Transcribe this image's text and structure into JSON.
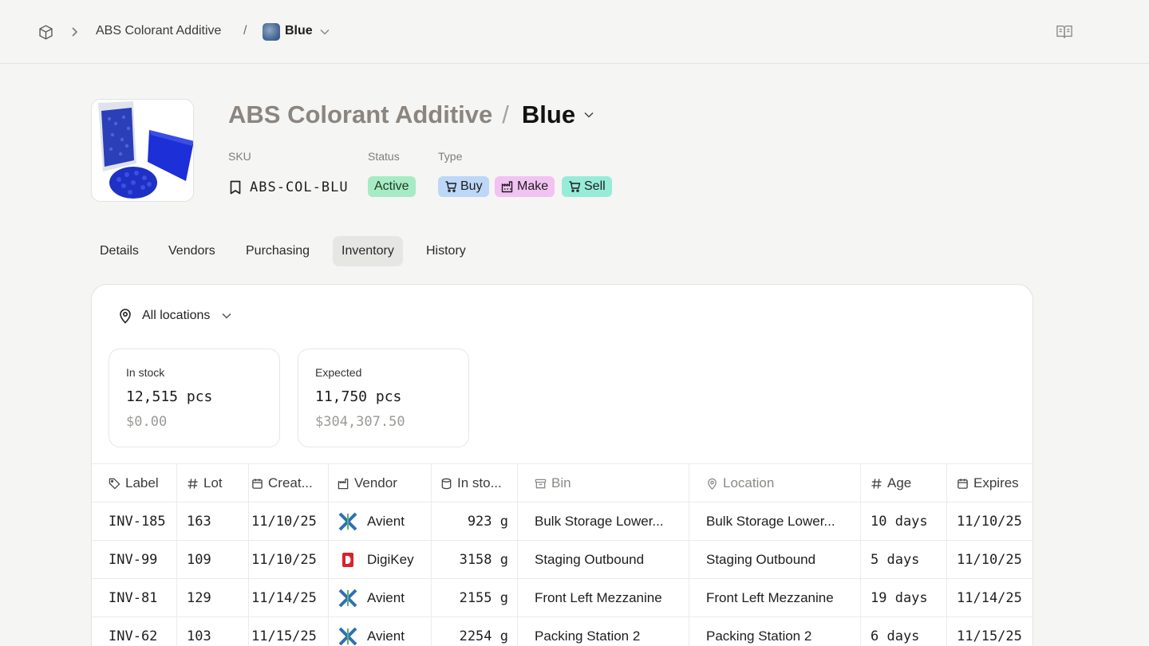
{
  "breadcrumb": {
    "parent": "ABS Colorant Additive",
    "separator": "/",
    "current": "Blue"
  },
  "header": {
    "title_parent": "ABS Colorant Additive",
    "title_separator": "/",
    "title_current": "Blue",
    "sku_label": "SKU",
    "sku_value": "ABS-COL-BLU",
    "status_label": "Status",
    "status_value": "Active",
    "type_label": "Type",
    "types": [
      "Buy",
      "Make",
      "Sell"
    ]
  },
  "tabs": [
    "Details",
    "Vendors",
    "Purchasing",
    "Inventory",
    "History"
  ],
  "active_tab": "Inventory",
  "inventory": {
    "location_filter": "All locations",
    "in_stock": {
      "label": "In stock",
      "quantity": "12,515 pcs",
      "value": "$0.00"
    },
    "expected": {
      "label": "Expected",
      "quantity": "11,750 pcs",
      "value": "$304,307.50"
    }
  },
  "table": {
    "headers": [
      "Label",
      "Lot",
      "Creat...",
      "Vendor",
      "In sto...",
      "Bin",
      "Location",
      "Age",
      "Expires"
    ],
    "rows": [
      {
        "label": "INV-185",
        "lot": "163",
        "created": "11/10/25",
        "vendor": "Avient",
        "in_stock": "923 g",
        "bin": "Bulk Storage Lower...",
        "location": "Bulk Storage Lower...",
        "age": "10 days",
        "expires": "11/10/25"
      },
      {
        "label": "INV-99",
        "lot": "109",
        "created": "11/10/25",
        "vendor": "DigiKey",
        "in_stock": "3158 g",
        "bin": "Staging Outbound",
        "location": "Staging Outbound",
        "age": "5 days",
        "expires": "11/10/25"
      },
      {
        "label": "INV-81",
        "lot": "129",
        "created": "11/14/25",
        "vendor": "Avient",
        "in_stock": "2155 g",
        "bin": "Front Left Mezzanine",
        "location": "Front Left Mezzanine",
        "age": "19 days",
        "expires": "11/14/25"
      },
      {
        "label": "INV-62",
        "lot": "103",
        "created": "11/15/25",
        "vendor": "Avient",
        "in_stock": "2254 g",
        "bin": "Packing Station 2",
        "location": "Packing Station 2",
        "age": "6 days",
        "expires": "11/15/25"
      }
    ]
  },
  "colors": {
    "status_active": "#a6ebc3",
    "type_buy": "#bcd7f7",
    "type_make": "#f2c2f3",
    "type_sell": "#97ecd9",
    "digikey_red": "#d8232a",
    "avient_blue": "#2f6fb5"
  }
}
